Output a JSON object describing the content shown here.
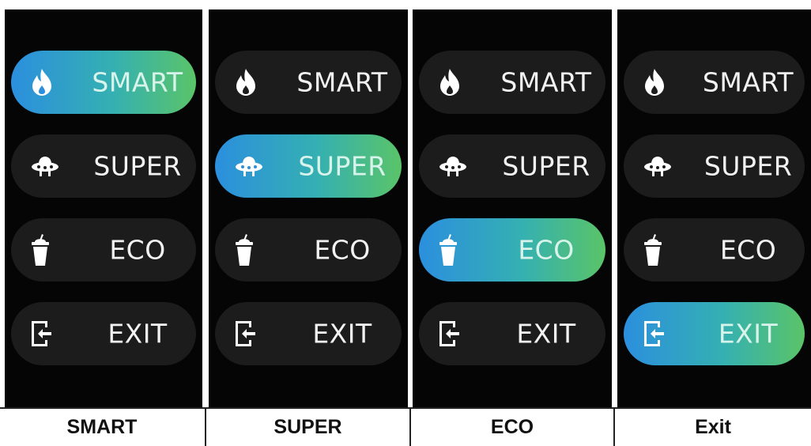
{
  "panels": [
    {
      "caption": "SMART",
      "active_index": 0,
      "items": [
        {
          "label": "SMART",
          "icon": "flame-icon"
        },
        {
          "label": "SUPER",
          "icon": "ufo-icon"
        },
        {
          "label": "ECO",
          "icon": "cup-icon"
        },
        {
          "label": "EXIT",
          "icon": "exit-door-icon"
        }
      ]
    },
    {
      "caption": "SUPER",
      "active_index": 1,
      "items": [
        {
          "label": "SMART",
          "icon": "flame-icon"
        },
        {
          "label": "SUPER",
          "icon": "ufo-icon"
        },
        {
          "label": "ECO",
          "icon": "cup-icon"
        },
        {
          "label": "EXIT",
          "icon": "exit-door-icon"
        }
      ]
    },
    {
      "caption": "ECO",
      "active_index": 2,
      "items": [
        {
          "label": "SMART",
          "icon": "flame-icon"
        },
        {
          "label": "SUPER",
          "icon": "ufo-icon"
        },
        {
          "label": "ECO",
          "icon": "cup-icon"
        },
        {
          "label": "EXIT",
          "icon": "exit-door-icon"
        }
      ]
    },
    {
      "caption": "Exit",
      "active_index": 3,
      "items": [
        {
          "label": "SMART",
          "icon": "flame-icon"
        },
        {
          "label": "SUPER",
          "icon": "ufo-icon"
        },
        {
          "label": "ECO",
          "icon": "cup-icon"
        },
        {
          "label": "EXIT",
          "icon": "exit-door-icon"
        }
      ]
    }
  ],
  "colors": {
    "panel_background": "#050505",
    "pill_inactive": "#1c1c1c",
    "pill_active_start": "#2b8fde",
    "pill_active_end": "#5ac468",
    "label_text": "#f2f2f2"
  }
}
